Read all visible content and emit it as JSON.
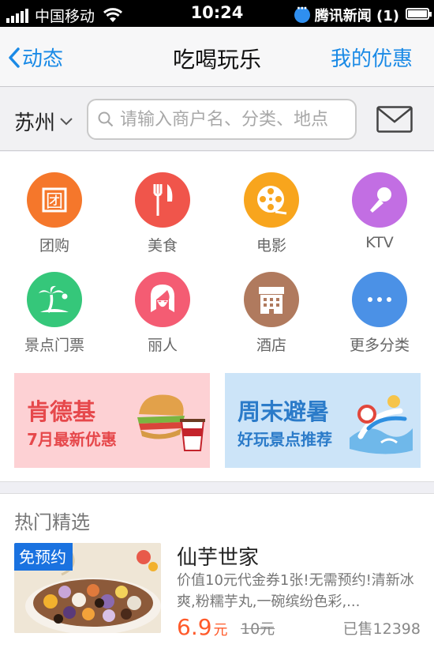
{
  "status_bar": {
    "carrier": "中国移动",
    "time": "10:24",
    "notification": "腾讯新闻 (1)"
  },
  "nav": {
    "back_label": "动态",
    "title": "吃喝玩乐",
    "right_label": "我的优惠"
  },
  "search": {
    "city": "苏州",
    "placeholder": "请输入商户名、分类、地点"
  },
  "categories": [
    {
      "label": "团购",
      "icon": "group-buy-icon",
      "color": "#f5772b"
    },
    {
      "label": "美食",
      "icon": "fork-knife-icon",
      "color": "#f0554b"
    },
    {
      "label": "电影",
      "icon": "film-reel-icon",
      "color": "#f8a51d"
    },
    {
      "label": "KTV",
      "icon": "microphone-icon",
      "color": "#c26ee3"
    },
    {
      "label": "景点门票",
      "icon": "palm-tree-icon",
      "color": "#35c77a"
    },
    {
      "label": "丽人",
      "icon": "woman-face-icon",
      "color": "#f45c73"
    },
    {
      "label": "酒店",
      "icon": "hotel-icon",
      "color": "#b07a5e"
    },
    {
      "label": "更多分类",
      "icon": "more-icon",
      "color": "#4b91e6"
    }
  ],
  "banners": [
    {
      "title": "肯德基",
      "subtitle": "7月最新优惠",
      "bg": "#fdd1d4",
      "color": "#e6484b",
      "icon": "burger-meal-icon"
    },
    {
      "title": "周末避暑",
      "subtitle": "好玩景点推荐",
      "bg": "#cce4f8",
      "color": "#2b7bc9",
      "icon": "water-park-icon"
    }
  ],
  "hot": {
    "section_title": "热门精选",
    "deal": {
      "badge": "免预约",
      "name": "仙芋世家",
      "description": "价值10元代金券1张!无需预约!清新冰爽,粉糯芋丸,一碗缤纷色彩,...",
      "price": "6.9",
      "price_unit": "元",
      "original_price": "10元",
      "sold": "已售12398"
    }
  },
  "colors": {
    "accent": "#1a8ae6",
    "price": "#ff5a2a"
  }
}
